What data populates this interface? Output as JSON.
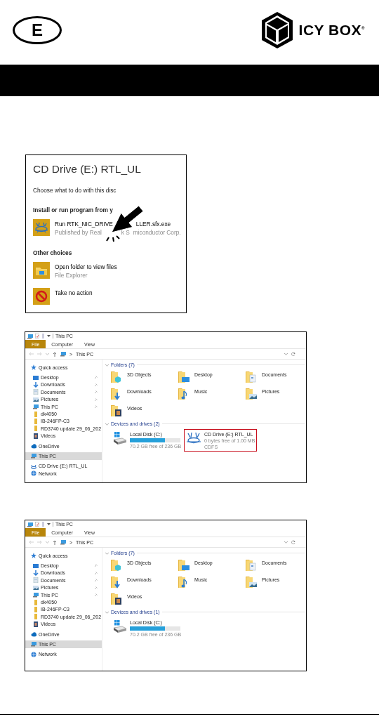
{
  "header": {
    "language_badge": "E",
    "logo_text": "ICY BOX$^{®}$"
  },
  "autoplay_dialog": {
    "title": "CD Drive (E:) RTL_UL",
    "prompt": "Choose what to do with this disc",
    "sections": [
      {
        "heading": "Install or run program from y",
        "options": [
          {
            "kind": "realtek",
            "title_parts": [
              "Run RTK_NIC_DRIVE",
              "LLER.sfx.exe"
            ],
            "subtitle_parts": [
              "Published by Real",
              "k S",
              "miconductor Corp."
            ]
          }
        ]
      },
      {
        "heading": "Other choices",
        "options": [
          {
            "kind": "explorer",
            "title_parts": [
              "Open folder to view files"
            ],
            "subtitle_parts": [
              "File Explorer"
            ]
          },
          {
            "kind": "none",
            "title_parts": [
              "Take no action"
            ]
          }
        ]
      }
    ]
  },
  "explorer_windows": [
    {
      "title": "This PC",
      "ribbon_tabs": [
        {
          "label": "File",
          "kind": "file"
        },
        {
          "label": "Computer",
          "kind": "tab"
        },
        {
          "label": "View",
          "kind": "tab"
        }
      ],
      "address": {
        "separator": ">",
        "location": "This PC"
      },
      "nav": [
        {
          "label": "Quick access",
          "kind": "star",
          "pinned": false,
          "selected": false,
          "children": [
            {
              "label": "Desktop",
              "kind": "desktop",
              "pinned": true,
              "selected": false
            },
            {
              "label": "Downloads",
              "kind": "download",
              "pinned": true,
              "selected": false
            },
            {
              "label": "Documents",
              "kind": "documents",
              "pinned": true,
              "selected": false
            },
            {
              "label": "Pictures",
              "kind": "pictures",
              "pinned": true,
              "selected": false
            },
            {
              "label": "This PC",
              "kind": "pc",
              "pinned": true,
              "selected": false
            },
            {
              "label": "dk4050",
              "kind": "folder",
              "pinned": false,
              "selected": false
            },
            {
              "label": "IB-246FP-C3",
              "kind": "folder",
              "pinned": false,
              "selected": false
            },
            {
              "label": "RD3740 update 29_06_202",
              "kind": "folder",
              "pinned": false,
              "selected": false
            },
            {
              "label": "Videos",
              "kind": "videos",
              "pinned": false,
              "selected": false
            }
          ]
        },
        {
          "label": "OneDrive",
          "kind": "cloud",
          "pinned": false,
          "selected": false
        },
        {
          "label": "This PC",
          "kind": "pc",
          "pinned": false,
          "selected": true
        },
        {
          "label": "CD Drive (E:) RTL_UL",
          "kind": "cd",
          "pinned": false,
          "selected": false
        },
        {
          "label": "Network",
          "kind": "network",
          "pinned": false,
          "selected": false
        }
      ],
      "folders_heading": "Folders (7)",
      "folders": [
        {
          "name": "3D Objects",
          "kind": "objects"
        },
        {
          "name": "Desktop",
          "kind": "desktop"
        },
        {
          "name": "Documents",
          "kind": "documents"
        },
        {
          "name": "Downloads",
          "kind": "download"
        },
        {
          "name": "Music",
          "kind": "music"
        },
        {
          "name": "Pictures",
          "kind": "pictures"
        },
        {
          "name": "Videos",
          "kind": "videos"
        }
      ],
      "drives_heading": "Devices and drives (2)",
      "drives": [
        {
          "kind": "disk",
          "name": "Local Disk (C:)",
          "level": 0.7,
          "free": "70.2 GB free of 236 GB",
          "highlighted": false
        },
        {
          "kind": "cd",
          "name": "CD Drive (E:) RTL_UL",
          "free": "0 bytes free of 1.00 MB",
          "filesystem": "CDFS",
          "highlighted": true
        }
      ]
    },
    {
      "title": "This PC",
      "ribbon_tabs": [
        {
          "label": "File",
          "kind": "file"
        },
        {
          "label": "Computer",
          "kind": "tab"
        },
        {
          "label": "View",
          "kind": "tab"
        }
      ],
      "address": {
        "separator": ">",
        "location": "This PC"
      },
      "nav": [
        {
          "label": "Quick access",
          "kind": "star",
          "pinned": false,
          "selected": false,
          "children": [
            {
              "label": "Desktop",
              "kind": "desktop",
              "pinned": true,
              "selected": false
            },
            {
              "label": "Downloads",
              "kind": "download",
              "pinned": true,
              "selected": false
            },
            {
              "label": "Documents",
              "kind": "documents",
              "pinned": true,
              "selected": false
            },
            {
              "label": "Pictures",
              "kind": "pictures",
              "pinned": true,
              "selected": false
            },
            {
              "label": "This PC",
              "kind": "pc",
              "pinned": true,
              "selected": false
            },
            {
              "label": "dk4050",
              "kind": "folder",
              "pinned": false,
              "selected": false
            },
            {
              "label": "IB-246FP-C3",
              "kind": "folder",
              "pinned": false,
              "selected": false
            },
            {
              "label": "RD3740 update 29_06_202",
              "kind": "folder",
              "pinned": false,
              "selected": false
            },
            {
              "label": "Videos",
              "kind": "videos",
              "pinned": false,
              "selected": false
            }
          ]
        },
        {
          "label": "OneDrive",
          "kind": "cloud",
          "pinned": false,
          "selected": false
        },
        {
          "label": "This PC",
          "kind": "pc",
          "pinned": false,
          "selected": true
        },
        {
          "label": "Network",
          "kind": "network",
          "pinned": false,
          "selected": false
        }
      ],
      "folders_heading": "Folders (7)",
      "folders": [
        {
          "name": "3D Objects",
          "kind": "objects"
        },
        {
          "name": "Desktop",
          "kind": "desktop"
        },
        {
          "name": "Documents",
          "kind": "documents"
        },
        {
          "name": "Downloads",
          "kind": "download"
        },
        {
          "name": "Music",
          "kind": "music"
        },
        {
          "name": "Pictures",
          "kind": "pictures"
        },
        {
          "name": "Videos",
          "kind": "videos"
        }
      ],
      "drives_heading": "Devices and drives (1)",
      "drives": [
        {
          "kind": "disk",
          "name": "Local Disk (C:)",
          "level": 0.7,
          "free": "70.2 GB free of 236 GB",
          "highlighted": false
        }
      ]
    }
  ]
}
